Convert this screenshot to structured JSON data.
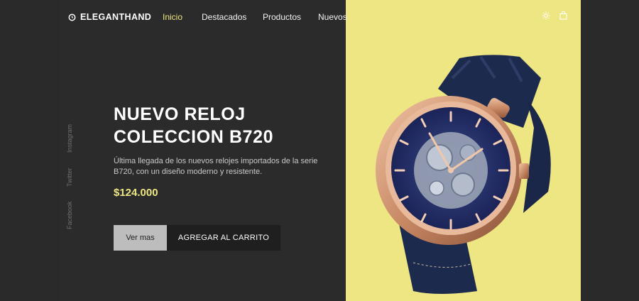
{
  "header": {
    "brand": "ELEGANTHAND",
    "nav": [
      {
        "label": "Inicio",
        "active": true
      },
      {
        "label": "Destacados",
        "active": false
      },
      {
        "label": "Productos",
        "active": false
      },
      {
        "label": "Nuevos",
        "active": false
      }
    ],
    "icons": [
      "theme-toggle-icon",
      "shopping-bag-icon"
    ]
  },
  "social": [
    "Instagram",
    "Twitter",
    "Facebook"
  ],
  "hero": {
    "title_line1": "NUEVO RELOJ",
    "title_line2": "COLECCION B720",
    "description": "Última llegada de los nuevos relojes importados de la serie B720, con un diseño moderno y resistente.",
    "price": "$124.000",
    "button_primary": "Ver mas",
    "button_secondary": "AGREGAR AL CARRITO",
    "product_image": "wristwatch-image"
  },
  "colors": {
    "background": "#2b2b2c",
    "accent": "#ede682",
    "button_primary_bg": "#bdbdbd",
    "button_secondary_bg": "#1f1f1f"
  }
}
